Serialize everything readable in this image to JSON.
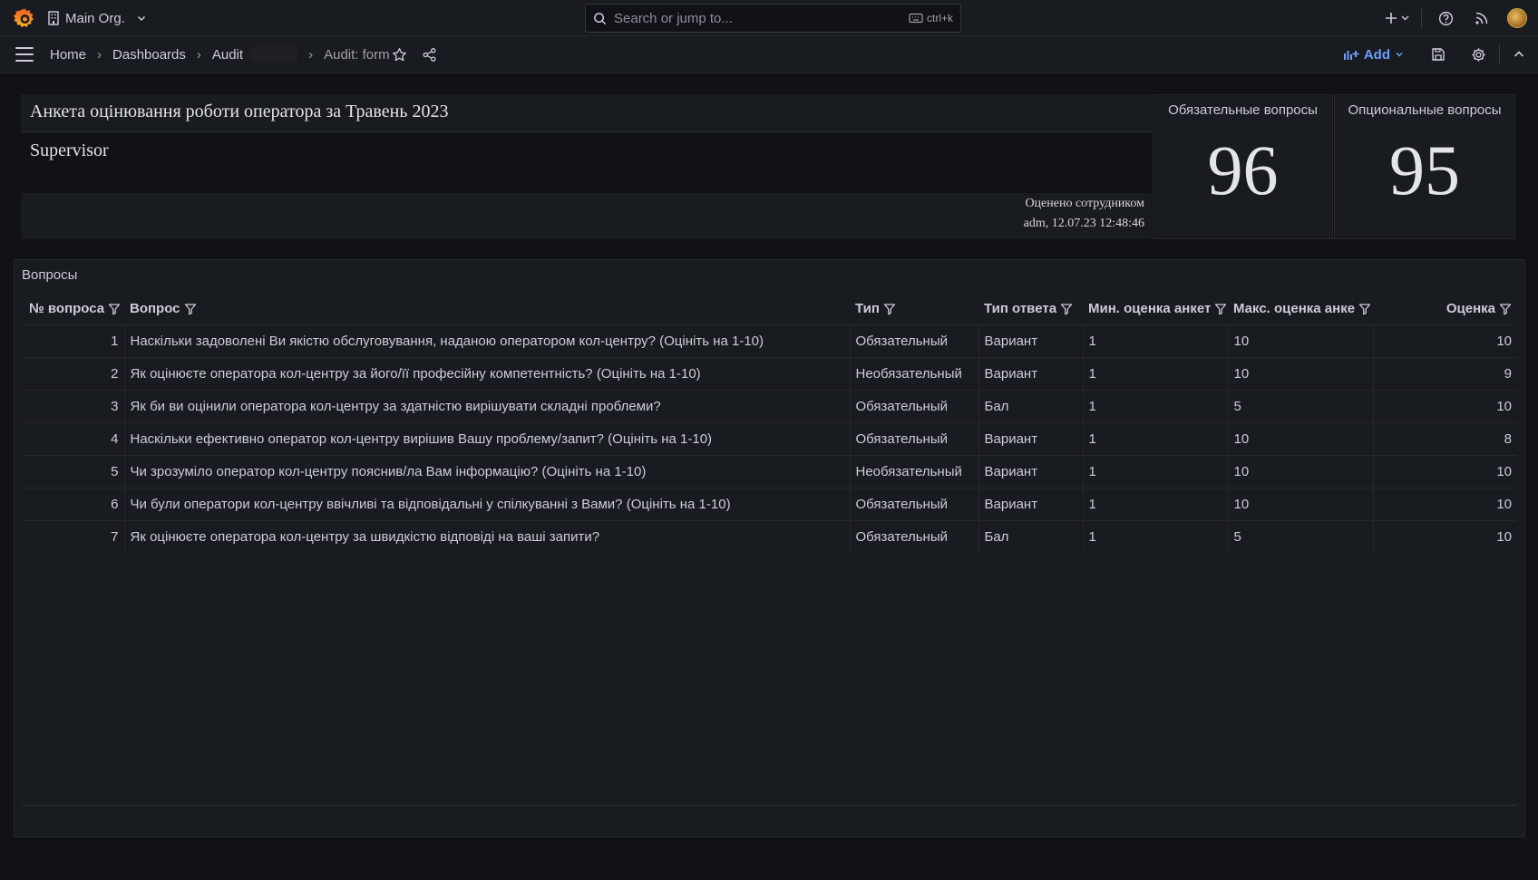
{
  "topbar": {
    "org_name": "Main Org.",
    "search_placeholder": "Search or jump to...",
    "search_shortcut": "ctrl+k"
  },
  "breadcrumb": {
    "home": "Home",
    "dashboards": "Dashboards",
    "folder": "Audit",
    "current": "Audit: form"
  },
  "toolbar": {
    "add_label": "Add"
  },
  "header": {
    "title": "Анкета оцінювання роботи оператора за Травень 2023",
    "subtitle": "Supervisor",
    "footer_line1": "Оценено сотрудником",
    "footer_line2": "adm, 12.07.23 12:48:46"
  },
  "stats": {
    "mandatory": {
      "label": "Обязательные вопросы",
      "value": "96"
    },
    "optional": {
      "label": "Опциональные вопросы",
      "value": "95"
    }
  },
  "questions_panel": {
    "title": "Вопросы",
    "columns": [
      "№ вопроса",
      "Вопрос",
      "Тип",
      "Тип ответа",
      "Мин. оценка анкет",
      "Макс. оценка анке",
      "Оценка"
    ],
    "rows": [
      [
        "1",
        "Наскільки задоволені Ви якістю обслуговування, наданою оператором кол-центру? (Оцініть на 1-10)",
        "Обязательный",
        "Вариант",
        "1",
        "10",
        "10"
      ],
      [
        "2",
        "Як оцінюєте оператора кол-центру за його/її професійну компетентність? (Оцініть на 1-10)",
        "Необязательный",
        "Вариант",
        "1",
        "10",
        "9"
      ],
      [
        "3",
        "Як би ви оцінили оператора кол-центру за здатністю вирішувати складні проблеми?",
        "Обязательный",
        "Бал",
        "1",
        "5",
        "10"
      ],
      [
        "4",
        "Наскільки ефективно оператор кол-центру вирішив Вашу проблему/запит? (Оцініть на 1-10)",
        "Обязательный",
        "Вариант",
        "1",
        "10",
        "8"
      ],
      [
        "5",
        "Чи зрозуміло оператор кол-центру пояснив/ла Вам інформацію? (Оцініть на 1-10)",
        "Необязательный",
        "Вариант",
        "1",
        "10",
        "10"
      ],
      [
        "6",
        "Чи були оператори кол-центру ввічливі та відповідальні у спілкуванні з Вами? (Оцініть на 1-10)",
        "Обязательный",
        "Вариант",
        "1",
        "10",
        "10"
      ],
      [
        "7",
        "Як оцінюєте оператора кол-центру за швидкістю відповіді на ваші запити?",
        "Обязательный",
        "Бал",
        "1",
        "5",
        "10"
      ]
    ]
  },
  "colors": {
    "background": "#111217",
    "panel": "#181b1f",
    "accent_blue": "#6e9fff",
    "score_green": "#73bf69"
  }
}
